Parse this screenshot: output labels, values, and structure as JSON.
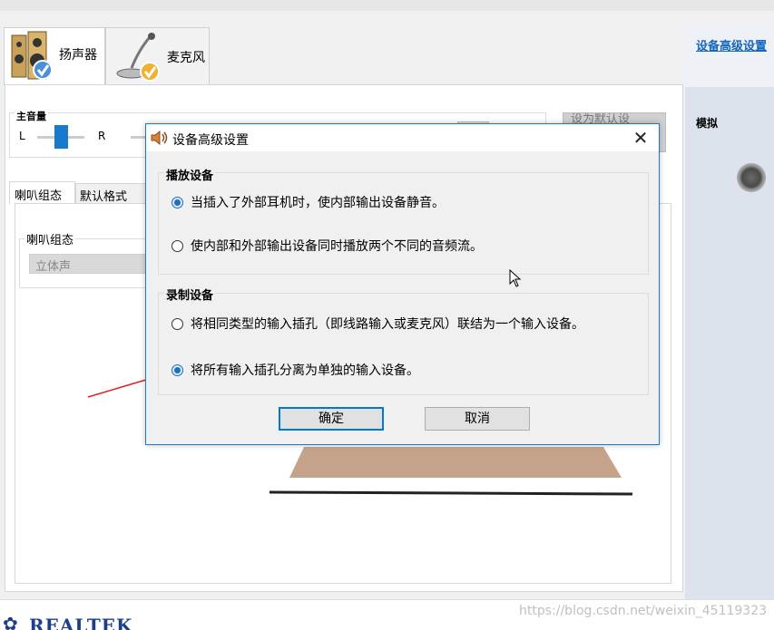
{
  "device_tabs": [
    {
      "label": "扬声器",
      "active": true
    },
    {
      "label": "麦克风",
      "active": false
    }
  ],
  "main": {
    "volume_label": "主音量",
    "left_channel": "L",
    "right_channel": "R",
    "set_default_button": "设为默认设",
    "sub_tabs": [
      "喇叭组态",
      "默认格式"
    ],
    "speaker_config_label": "喇叭组态",
    "speaker_config_value": "立体声"
  },
  "right_panel": {
    "link": "设备高级设置",
    "label": "模拟"
  },
  "dialog": {
    "title": "设备高级设置",
    "close": "✕",
    "playback": {
      "title": "播放设备",
      "options": [
        {
          "label": "当插入了外部耳机时，使内部输出设备静音。",
          "checked": true
        },
        {
          "label": "使内部和外部输出设备同时播放两个不同的音频流。",
          "checked": false
        }
      ]
    },
    "recording": {
      "title": "录制设备",
      "options": [
        {
          "label": "将相同类型的输入插孔（即线路输入或麦克风）联结为一个输入设备。",
          "checked": false
        },
        {
          "label": "将所有输入插孔分离为单独的输入设备。",
          "checked": true
        }
      ]
    },
    "ok_button": "确定",
    "cancel_button": "取消"
  },
  "brand": "REALTEK",
  "watermark": "https://blog.csdn.net/weixin_45119323",
  "colors": {
    "accent": "#0078d7",
    "link": "#1565c0",
    "arrow": "#e02020",
    "brand": "#1d3f8a"
  }
}
